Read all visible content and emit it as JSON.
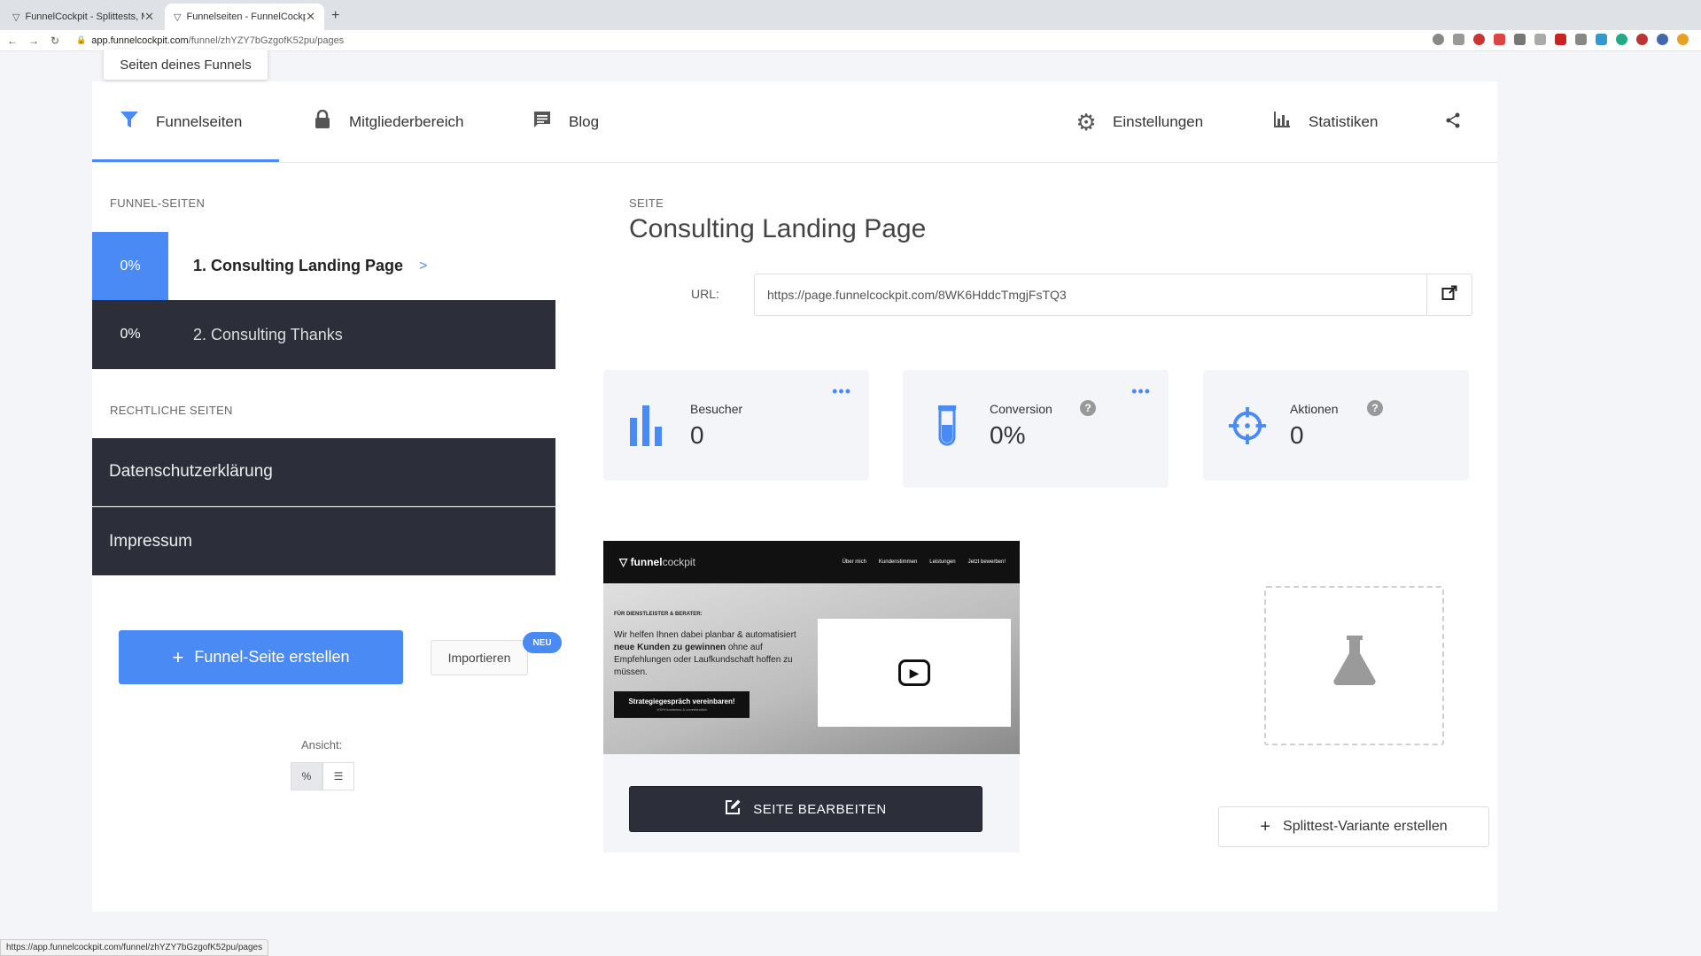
{
  "browser": {
    "tabs": [
      {
        "title": "FunnelCockpit - Splittests, Ma",
        "active": false
      },
      {
        "title": "Funnelseiten - FunnelCockpit",
        "active": true
      }
    ],
    "url_host": "app.funnelcockpit.com",
    "url_path": "/funnel/zhYZY7bGzgofK52pu/pages",
    "status_url": "https://app.funnelcockpit.com/funnel/zhYZY7bGzgofK52pu/pages"
  },
  "tooltip": "Seiten deines Funnels",
  "nav": {
    "funnelseiten": "Funnelseiten",
    "mitgliederbereich": "Mitgliederbereich",
    "blog": "Blog",
    "einstellungen": "Einstellungen",
    "statistiken": "Statistiken"
  },
  "sidebar": {
    "funnel_label": "FUNNEL-SEITEN",
    "pages": [
      {
        "pct": "0%",
        "name": "1. Consulting Landing Page",
        "arrow": ">"
      },
      {
        "pct": "0%",
        "name": "2. Consulting Thanks"
      }
    ],
    "legal_label": "RECHTLICHE SEITEN",
    "legal": [
      "Datenschutzerklärung",
      "Impressum"
    ],
    "create_button": "Funnel-Seite erstellen",
    "import_button": "Importieren",
    "badge": "NEU",
    "view_label": "Ansicht:"
  },
  "main": {
    "section_label": "SEITE",
    "title": "Consulting Landing Page",
    "url_label": "URL:",
    "url_value": "https://page.funnelcockpit.com/8WK6HddcTmgjFsTQ3",
    "stats": [
      {
        "label": "Besucher",
        "value": "0",
        "icon": "bar-chart-icon"
      },
      {
        "label": "Conversion",
        "value": "0%",
        "icon": "test-tube-icon"
      },
      {
        "label": "Aktionen",
        "value": "0",
        "icon": "crosshair-icon"
      }
    ],
    "edit_button": "SEITE BEARBEITEN",
    "splittest_button": "Splittest-Variante erstellen"
  },
  "preview": {
    "logo_main": "funnel",
    "logo_sub": "cockpit",
    "nav": [
      "Über mich",
      "Kundenstimmen",
      "Leistungen",
      "Jetzt bewerben!"
    ],
    "tag": "FÜR DIENSTLEISTER & BERATER:",
    "text_1": "Wir helfen Ihnen dabei planbar & automatisiert",
    "text_bold": "neue Kunden zu gewinnen",
    "text_2": "ohne auf Empfehlungen oder Laufkundschaft hoffen zu müssen.",
    "cta": "Strategiegespräch vereinbaren!",
    "cta_sub": "100% kostenlos & unverbindlich"
  },
  "colors": {
    "accent": "#4a8af4",
    "dark": "#2c2f3a"
  }
}
